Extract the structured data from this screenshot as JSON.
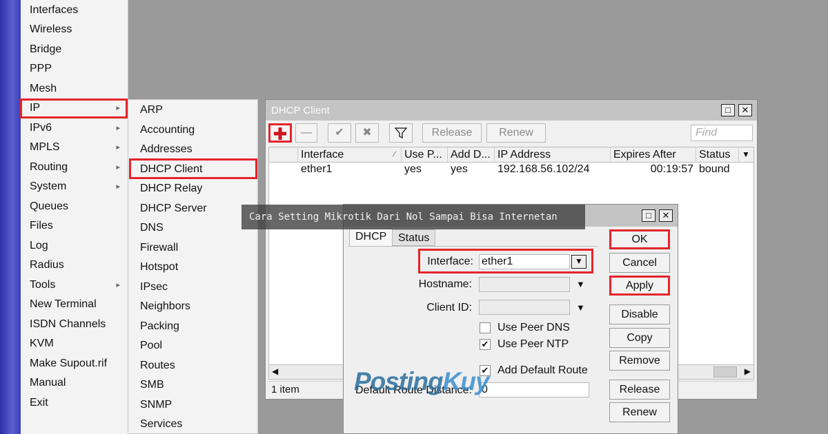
{
  "main_menu": {
    "items": [
      {
        "label": "Interfaces"
      },
      {
        "label": "Wireless"
      },
      {
        "label": "Bridge"
      },
      {
        "label": "PPP"
      },
      {
        "label": "Mesh"
      },
      {
        "label": "IP",
        "has_submenu": true
      },
      {
        "label": "IPv6",
        "has_submenu": true
      },
      {
        "label": "MPLS",
        "has_submenu": true
      },
      {
        "label": "Routing",
        "has_submenu": true
      },
      {
        "label": "System",
        "has_submenu": true
      },
      {
        "label": "Queues"
      },
      {
        "label": "Files"
      },
      {
        "label": "Log"
      },
      {
        "label": "Radius"
      },
      {
        "label": "Tools",
        "has_submenu": true
      },
      {
        "label": "New Terminal"
      },
      {
        "label": "ISDN Channels"
      },
      {
        "label": "KVM"
      },
      {
        "label": "Make Supout.rif"
      },
      {
        "label": "Manual"
      },
      {
        "label": "Exit"
      }
    ],
    "submenu_arrow": "▸"
  },
  "ip_submenu": {
    "items": [
      {
        "label": "ARP"
      },
      {
        "label": "Accounting"
      },
      {
        "label": "Addresses"
      },
      {
        "label": "DHCP Client"
      },
      {
        "label": "DHCP Relay"
      },
      {
        "label": "DHCP Server"
      },
      {
        "label": "DNS"
      },
      {
        "label": "Firewall"
      },
      {
        "label": "Hotspot"
      },
      {
        "label": "IPsec"
      },
      {
        "label": "Neighbors"
      },
      {
        "label": "Packing"
      },
      {
        "label": "Pool"
      },
      {
        "label": "Routes"
      },
      {
        "label": "SMB"
      },
      {
        "label": "SNMP"
      },
      {
        "label": "Services"
      }
    ]
  },
  "dhcp_client_window": {
    "title": "DHCP Client",
    "toolbar": {
      "release_label": "Release",
      "renew_label": "Renew",
      "find_placeholder": "Find"
    },
    "columns": [
      "Interface",
      "Use P...",
      "Add D...",
      "IP Address",
      "Expires After",
      "Status"
    ],
    "rows": [
      {
        "interface": "ether1",
        "use_peer_dns": "yes",
        "add_default_route": "yes",
        "ip_address": "192.168.56.102/24",
        "expires_after": "00:19:57",
        "status": "bound"
      }
    ],
    "status_text": "1 item"
  },
  "caption": "Cara Setting Mikrotik Dari Nol Sampai Bisa Internetan",
  "dialog": {
    "tabs": [
      "DHCP",
      "Status"
    ],
    "interface_label": "Interface:",
    "interface_value": "ether1",
    "hostname_label": "Hostname:",
    "client_id_label": "Client ID:",
    "use_peer_dns_label": "Use Peer DNS",
    "use_peer_dns_checked": false,
    "use_peer_ntp_label": "Use Peer NTP",
    "use_peer_ntp_checked": true,
    "add_default_route_label": "Add Default Route",
    "add_default_route_checked": true,
    "default_route_distance_label": "Default Route Distance:",
    "default_route_distance_value": "0",
    "buttons": {
      "ok": "OK",
      "cancel": "Cancel",
      "apply": "Apply",
      "disable": "Disable",
      "copy": "Copy",
      "remove": "Remove",
      "release": "Release",
      "renew": "Renew"
    }
  },
  "watermark": {
    "part1": "Posting",
    "part2": "Kuy"
  },
  "colors": {
    "highlight": "#e3242b",
    "add_icon": "#d0141c",
    "menu_strip": "#3b3fb8"
  }
}
